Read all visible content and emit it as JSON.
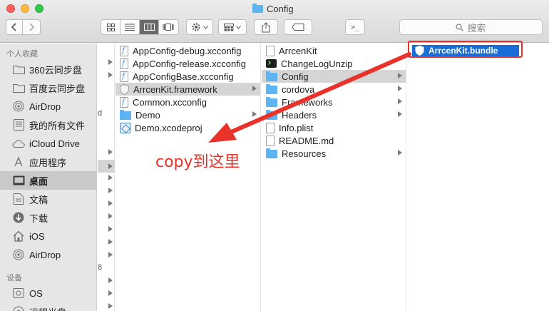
{
  "window": {
    "title": "Config"
  },
  "toolbar": {
    "search_placeholder": "搜索",
    "terminal_label": ">_"
  },
  "sidebar": {
    "favorites_header": "个人收藏",
    "devices_header": "设备",
    "items": [
      {
        "label": "360云同步盘",
        "icon": "folder-icon"
      },
      {
        "label": "百度云同步盘",
        "icon": "folder-icon"
      },
      {
        "label": "AirDrop",
        "icon": "airdrop-icon"
      },
      {
        "label": "我的所有文件",
        "icon": "all-files-icon"
      },
      {
        "label": "iCloud Drive",
        "icon": "cloud-icon"
      },
      {
        "label": "应用程序",
        "icon": "applications-icon"
      },
      {
        "label": "桌面",
        "icon": "desktop-icon",
        "selected": true
      },
      {
        "label": "文稿",
        "icon": "documents-icon"
      },
      {
        "label": "下载",
        "icon": "downloads-icon"
      },
      {
        "label": "iOS",
        "icon": "home-icon"
      },
      {
        "label": "AirDrop",
        "icon": "airdrop-icon"
      }
    ],
    "devices": [
      {
        "label": "OS",
        "icon": "disk-icon"
      },
      {
        "label": "远程光盘",
        "icon": "disc-icon"
      }
    ]
  },
  "column0": {
    "glyph_d": "d",
    "glyph_8": "8"
  },
  "column1": [
    {
      "name": "AppConfig-debug.xcconfig",
      "icon": "xcconfig-file-icon"
    },
    {
      "name": "AppConfig-release.xcconfig",
      "icon": "xcconfig-file-icon"
    },
    {
      "name": "AppConfigBase.xcconfig",
      "icon": "xcconfig-file-icon"
    },
    {
      "name": "ArrcenKit.framework",
      "icon": "framework-icon",
      "selected": true
    },
    {
      "name": "Common.xcconfig",
      "icon": "xcconfig-file-icon"
    },
    {
      "name": "Demo",
      "icon": "folder-icon"
    },
    {
      "name": "Demo.xcodeproj",
      "icon": "xcodeproj-icon"
    }
  ],
  "column2": [
    {
      "name": "ArrcenKit",
      "icon": "file-icon"
    },
    {
      "name": "ChangeLogUnzip",
      "icon": "terminal-icon"
    },
    {
      "name": "Config",
      "icon": "folder-icon",
      "selected": true
    },
    {
      "name": "cordova",
      "icon": "folder-icon"
    },
    {
      "name": "Frameworks",
      "icon": "folder-icon"
    },
    {
      "name": "Headers",
      "icon": "folder-icon"
    },
    {
      "name": "Info.plist",
      "icon": "plist-file-icon"
    },
    {
      "name": "README.md",
      "icon": "file-icon"
    },
    {
      "name": "Resources",
      "icon": "folder-icon"
    }
  ],
  "column3": [
    {
      "name": "ArrcenKit.bundle",
      "icon": "bundle-icon",
      "selected": true
    }
  ],
  "annotation": {
    "text": "copy到这里",
    "color": "#e8322a"
  },
  "colors": {
    "selection_blue": "#1a6cd6",
    "folder_blue": "#5cb4f1",
    "annotation_red": "#e8322a"
  }
}
